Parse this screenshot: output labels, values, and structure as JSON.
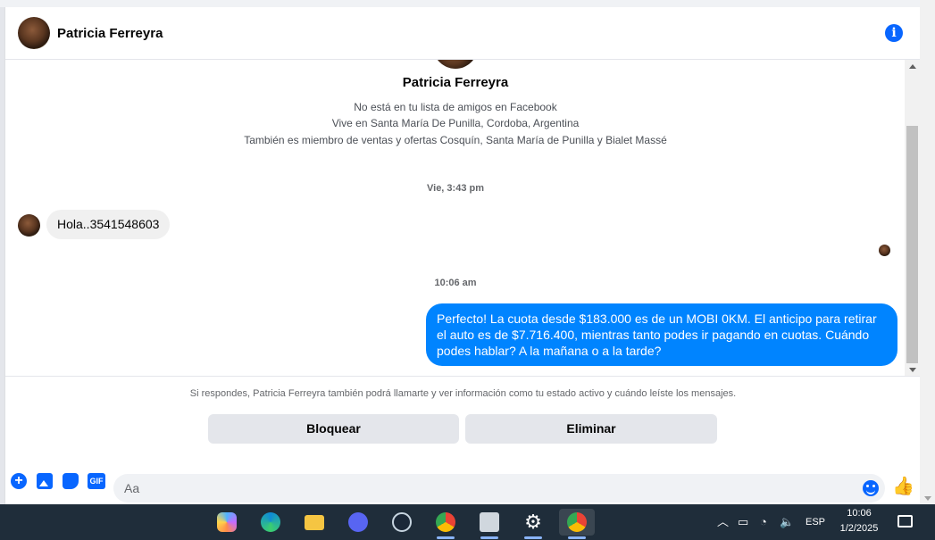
{
  "header": {
    "name": "Patricia Ferreyra",
    "info_icon": "info-icon"
  },
  "profile": {
    "name": "Patricia Ferreyra",
    "lines": [
      "No está en tu lista de amigos en Facebook",
      "Vive en Santa María De Punilla, Cordoba, Argentina",
      "También es miembro de ventas y ofertas Cosquín, Santa María de Punilla y Bialet Massé"
    ]
  },
  "messages": {
    "timestamp_1": "Vie, 3:43 pm",
    "incoming_text": "Hola..3541548603",
    "timestamp_2": "10:06 am",
    "outgoing_text": "Perfecto! La cuota desde $183.000 es de un MOBI 0KM. El anticipo para retirar el auto es de $7.716.400, mientras tanto podes ir pagando en cuotas. Cuándo podes hablar? A la mañana o a la tarde?"
  },
  "footer": {
    "notice": "Si respondes, Patricia Ferreyra también podrá llamarte y ver información como tu estado activo y cuándo leíste los mensajes.",
    "block_label": "Bloquear",
    "delete_label": "Eliminar",
    "gif_label": "GIF",
    "composer_placeholder": "Aa"
  },
  "taskbar": {
    "language": "ESP",
    "time": "10:06",
    "date": "1/2/2025"
  },
  "colors": {
    "accent": "#0866ff",
    "outgoing_bubble": "#0084ff",
    "incoming_bubble": "#f0f0f0",
    "taskbar": "#1f2d3a"
  }
}
